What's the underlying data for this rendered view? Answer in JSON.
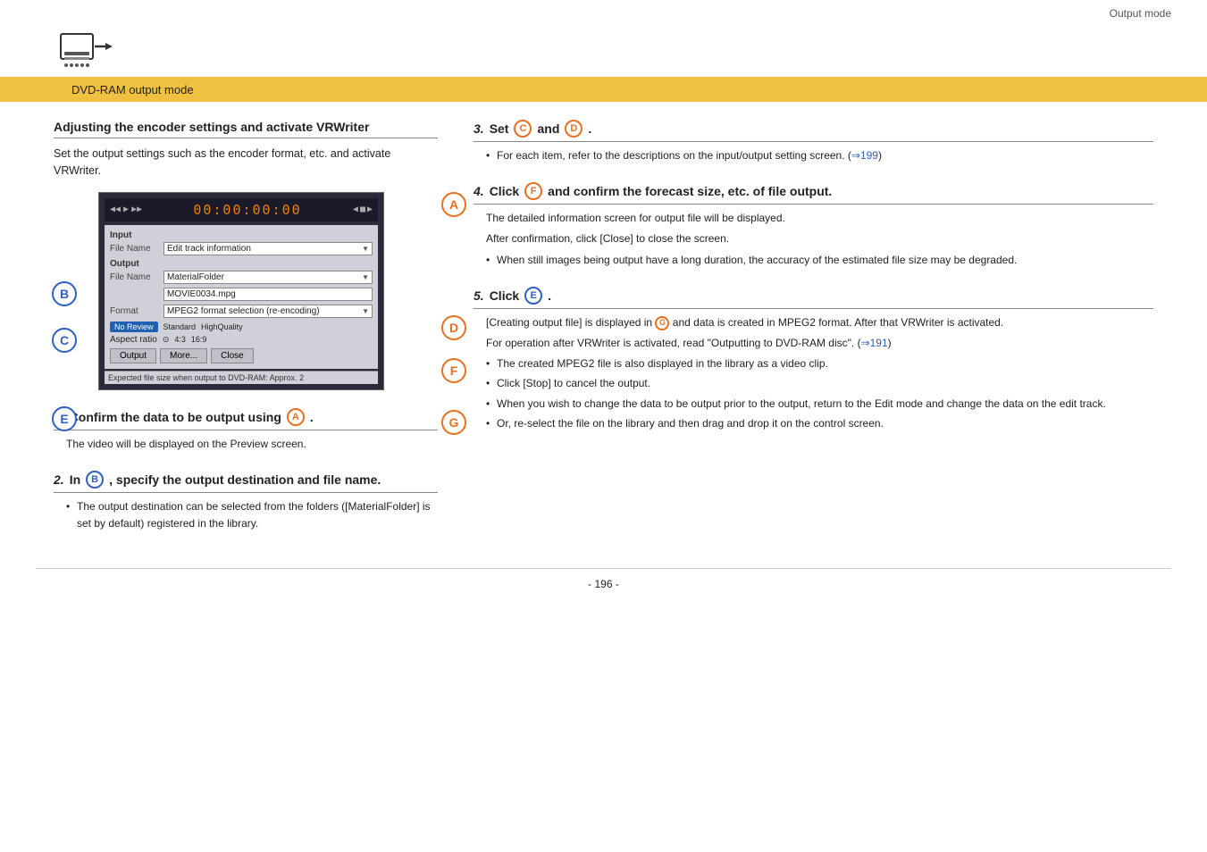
{
  "topbar": {
    "label": "Output mode"
  },
  "yellowbar": {
    "title": "DVD-RAM output mode"
  },
  "left": {
    "section_title": "Adjusting  the encoder settings and activate VRWriter",
    "section_body": "Set the output settings such as the encoder format, etc. and activate VRWriter.",
    "screen": {
      "timecode": "00:00:00:00",
      "input_section": "Input",
      "file_name_label": "File Name",
      "file_name_value": "Edit track information",
      "output_section": "Output",
      "output_file_name_label": "File Name",
      "output_file_name_value": "MaterialFolder",
      "movie_file": "MOVIE0034.mpg",
      "format_label": "Format",
      "format_value": "MPEG2 format selection (re-encoding)",
      "quality_options": [
        "No Review",
        "Standard",
        "HighQuality"
      ],
      "quality_selected": "No Review",
      "aspect_label": "Aspect ratio",
      "aspect_4_3": "4:3",
      "aspect_16_9": "16:9",
      "btn_output": "Output",
      "btn_more": "More...",
      "btn_close": "Close",
      "status_bar": "Expected file size when output to DVD-RAM: Approx. 2"
    },
    "labels": {
      "A": "A",
      "B": "B",
      "C": "C",
      "D": "D",
      "E": "E",
      "F": "F",
      "G": "G"
    }
  },
  "steps": {
    "step1": {
      "num": "1.",
      "title": "Confirm the data to be output using",
      "circle_label": "A",
      "body": "The video will be displayed on the Preview screen."
    },
    "step2": {
      "num": "2.",
      "title_pre": "In",
      "circle_label": "B",
      "title_post": ", specify the output destination and file name.",
      "bullets": [
        "The output destination can be selected from the folders ([MaterialFolder] is set by default) registered in the library."
      ]
    },
    "step3": {
      "num": "3.",
      "title_pre": "Set",
      "circle_C": "C",
      "title_mid": "and",
      "circle_D": "D",
      "title_post": ".",
      "bullets": [
        "For each item, refer to the descriptions on the input/output setting screen. (⇒199)"
      ]
    },
    "step4": {
      "num": "4.",
      "title_pre": "Click",
      "circle_label": "F",
      "title_post": "and confirm the forecast size, etc. of file output.",
      "body": "The detailed information screen for output file will be displayed.",
      "body2": "After confirmation, click [Close] to close the screen.",
      "bullets": [
        "When still images being output have a long duration, the accuracy of the estimated file size may be degraded."
      ]
    },
    "step5": {
      "num": "5.",
      "title_pre": "Click",
      "circle_label": "E",
      "title_post": ".",
      "body": "[Creating output file] is displayed in",
      "circle_G": "G",
      "body_mid": "and data is created in MPEG2 format. After that VRWriter is activated.",
      "body2": "For operation after VRWriter is activated, read \"Outputting to DVD-RAM disc\". (⇒191)",
      "bullets": [
        "The created MPEG2 file is also displayed in the library as a video clip.",
        "Click [Stop] to cancel the output.",
        "When you wish to change the data to be output prior to the output, return to the Edit mode and change the data on the edit track.",
        "Or, re-select the file on the library and then drag and drop it on the control screen."
      ]
    }
  },
  "page_number": "- 196 -"
}
